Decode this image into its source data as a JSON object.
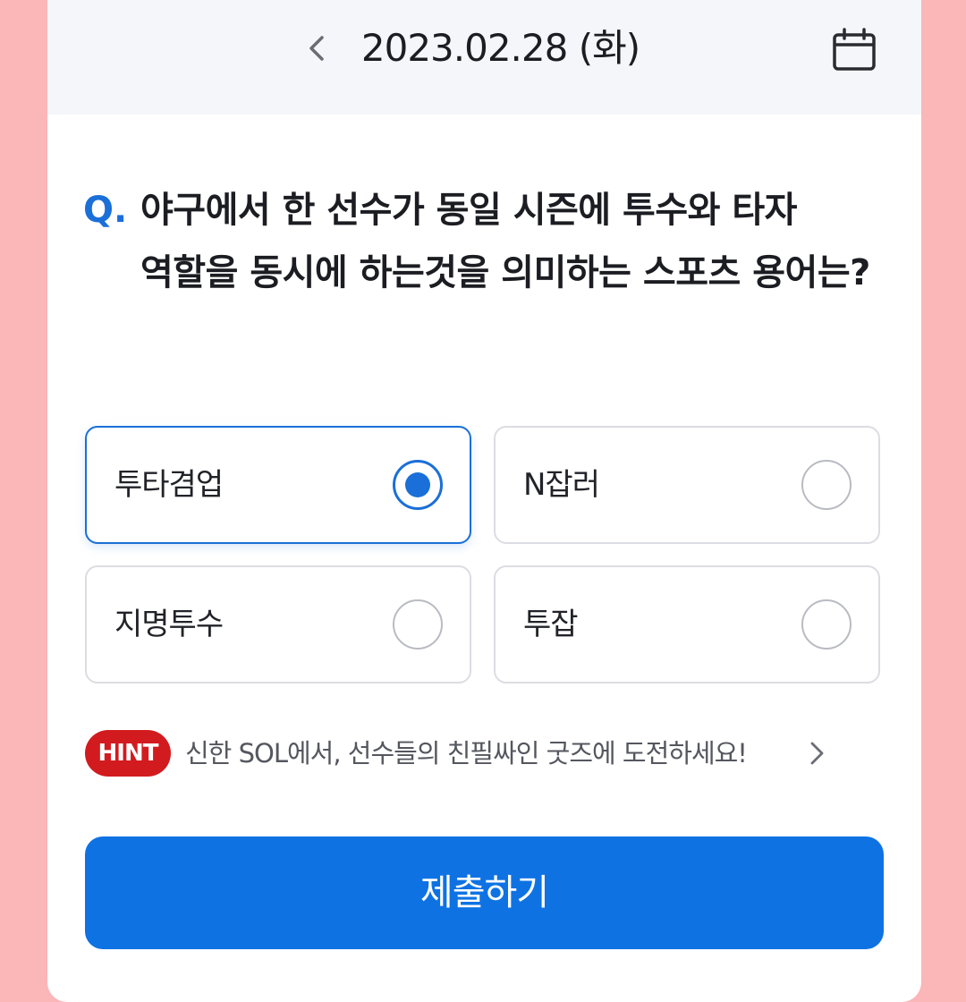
{
  "header": {
    "date": "2023.02.28 (화)",
    "prev_icon": "chevron-left-icon",
    "calendar_icon": "calendar-icon"
  },
  "question": {
    "prefix": "Q.",
    "text": "야구에서 한 선수가 동일 시즌에 투수와 타자 역할을 동시에 하는것을 의미하는 스포츠 용어는?"
  },
  "options": [
    {
      "label": "투타겸업",
      "selected": true
    },
    {
      "label": "N잡러",
      "selected": false
    },
    {
      "label": "지명투수",
      "selected": false
    },
    {
      "label": "투잡",
      "selected": false
    }
  ],
  "hint": {
    "badge": "HINT",
    "text": "신한 SOL에서, 선수들의 친필싸인 굿즈에 도전하세요!",
    "arrow_icon": "chevron-right-icon"
  },
  "submit": {
    "label": "제출하기"
  },
  "colors": {
    "accent": "#0e72e3",
    "hint_badge": "#d21b1f",
    "background": "#fbb6b8"
  }
}
